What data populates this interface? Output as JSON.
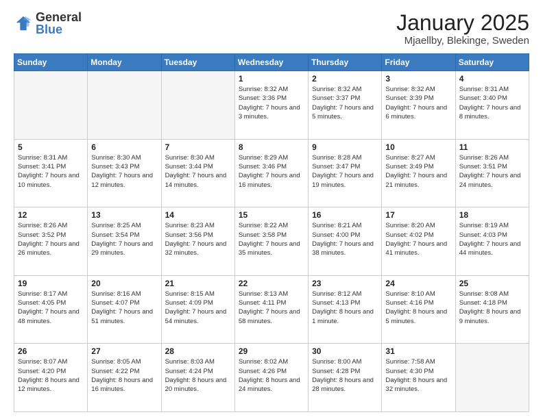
{
  "header": {
    "logo_general": "General",
    "logo_blue": "Blue",
    "title": "January 2025",
    "subtitle": "Mjaellby, Blekinge, Sweden"
  },
  "weekdays": [
    "Sunday",
    "Monday",
    "Tuesday",
    "Wednesday",
    "Thursday",
    "Friday",
    "Saturday"
  ],
  "weeks": [
    [
      {
        "day": "",
        "info": ""
      },
      {
        "day": "",
        "info": ""
      },
      {
        "day": "",
        "info": ""
      },
      {
        "day": "1",
        "info": "Sunrise: 8:32 AM\nSunset: 3:36 PM\nDaylight: 7 hours\nand 3 minutes."
      },
      {
        "day": "2",
        "info": "Sunrise: 8:32 AM\nSunset: 3:37 PM\nDaylight: 7 hours\nand 5 minutes."
      },
      {
        "day": "3",
        "info": "Sunrise: 8:32 AM\nSunset: 3:39 PM\nDaylight: 7 hours\nand 6 minutes."
      },
      {
        "day": "4",
        "info": "Sunrise: 8:31 AM\nSunset: 3:40 PM\nDaylight: 7 hours\nand 8 minutes."
      }
    ],
    [
      {
        "day": "5",
        "info": "Sunrise: 8:31 AM\nSunset: 3:41 PM\nDaylight: 7 hours\nand 10 minutes."
      },
      {
        "day": "6",
        "info": "Sunrise: 8:30 AM\nSunset: 3:43 PM\nDaylight: 7 hours\nand 12 minutes."
      },
      {
        "day": "7",
        "info": "Sunrise: 8:30 AM\nSunset: 3:44 PM\nDaylight: 7 hours\nand 14 minutes."
      },
      {
        "day": "8",
        "info": "Sunrise: 8:29 AM\nSunset: 3:46 PM\nDaylight: 7 hours\nand 16 minutes."
      },
      {
        "day": "9",
        "info": "Sunrise: 8:28 AM\nSunset: 3:47 PM\nDaylight: 7 hours\nand 19 minutes."
      },
      {
        "day": "10",
        "info": "Sunrise: 8:27 AM\nSunset: 3:49 PM\nDaylight: 7 hours\nand 21 minutes."
      },
      {
        "day": "11",
        "info": "Sunrise: 8:26 AM\nSunset: 3:51 PM\nDaylight: 7 hours\nand 24 minutes."
      }
    ],
    [
      {
        "day": "12",
        "info": "Sunrise: 8:26 AM\nSunset: 3:52 PM\nDaylight: 7 hours\nand 26 minutes."
      },
      {
        "day": "13",
        "info": "Sunrise: 8:25 AM\nSunset: 3:54 PM\nDaylight: 7 hours\nand 29 minutes."
      },
      {
        "day": "14",
        "info": "Sunrise: 8:23 AM\nSunset: 3:56 PM\nDaylight: 7 hours\nand 32 minutes."
      },
      {
        "day": "15",
        "info": "Sunrise: 8:22 AM\nSunset: 3:58 PM\nDaylight: 7 hours\nand 35 minutes."
      },
      {
        "day": "16",
        "info": "Sunrise: 8:21 AM\nSunset: 4:00 PM\nDaylight: 7 hours\nand 38 minutes."
      },
      {
        "day": "17",
        "info": "Sunrise: 8:20 AM\nSunset: 4:02 PM\nDaylight: 7 hours\nand 41 minutes."
      },
      {
        "day": "18",
        "info": "Sunrise: 8:19 AM\nSunset: 4:03 PM\nDaylight: 7 hours\nand 44 minutes."
      }
    ],
    [
      {
        "day": "19",
        "info": "Sunrise: 8:17 AM\nSunset: 4:05 PM\nDaylight: 7 hours\nand 48 minutes."
      },
      {
        "day": "20",
        "info": "Sunrise: 8:16 AM\nSunset: 4:07 PM\nDaylight: 7 hours\nand 51 minutes."
      },
      {
        "day": "21",
        "info": "Sunrise: 8:15 AM\nSunset: 4:09 PM\nDaylight: 7 hours\nand 54 minutes."
      },
      {
        "day": "22",
        "info": "Sunrise: 8:13 AM\nSunset: 4:11 PM\nDaylight: 7 hours\nand 58 minutes."
      },
      {
        "day": "23",
        "info": "Sunrise: 8:12 AM\nSunset: 4:13 PM\nDaylight: 8 hours\nand 1 minute."
      },
      {
        "day": "24",
        "info": "Sunrise: 8:10 AM\nSunset: 4:16 PM\nDaylight: 8 hours\nand 5 minutes."
      },
      {
        "day": "25",
        "info": "Sunrise: 8:08 AM\nSunset: 4:18 PM\nDaylight: 8 hours\nand 9 minutes."
      }
    ],
    [
      {
        "day": "26",
        "info": "Sunrise: 8:07 AM\nSunset: 4:20 PM\nDaylight: 8 hours\nand 12 minutes."
      },
      {
        "day": "27",
        "info": "Sunrise: 8:05 AM\nSunset: 4:22 PM\nDaylight: 8 hours\nand 16 minutes."
      },
      {
        "day": "28",
        "info": "Sunrise: 8:03 AM\nSunset: 4:24 PM\nDaylight: 8 hours\nand 20 minutes."
      },
      {
        "day": "29",
        "info": "Sunrise: 8:02 AM\nSunset: 4:26 PM\nDaylight: 8 hours\nand 24 minutes."
      },
      {
        "day": "30",
        "info": "Sunrise: 8:00 AM\nSunset: 4:28 PM\nDaylight: 8 hours\nand 28 minutes."
      },
      {
        "day": "31",
        "info": "Sunrise: 7:58 AM\nSunset: 4:30 PM\nDaylight: 8 hours\nand 32 minutes."
      },
      {
        "day": "",
        "info": ""
      }
    ]
  ]
}
